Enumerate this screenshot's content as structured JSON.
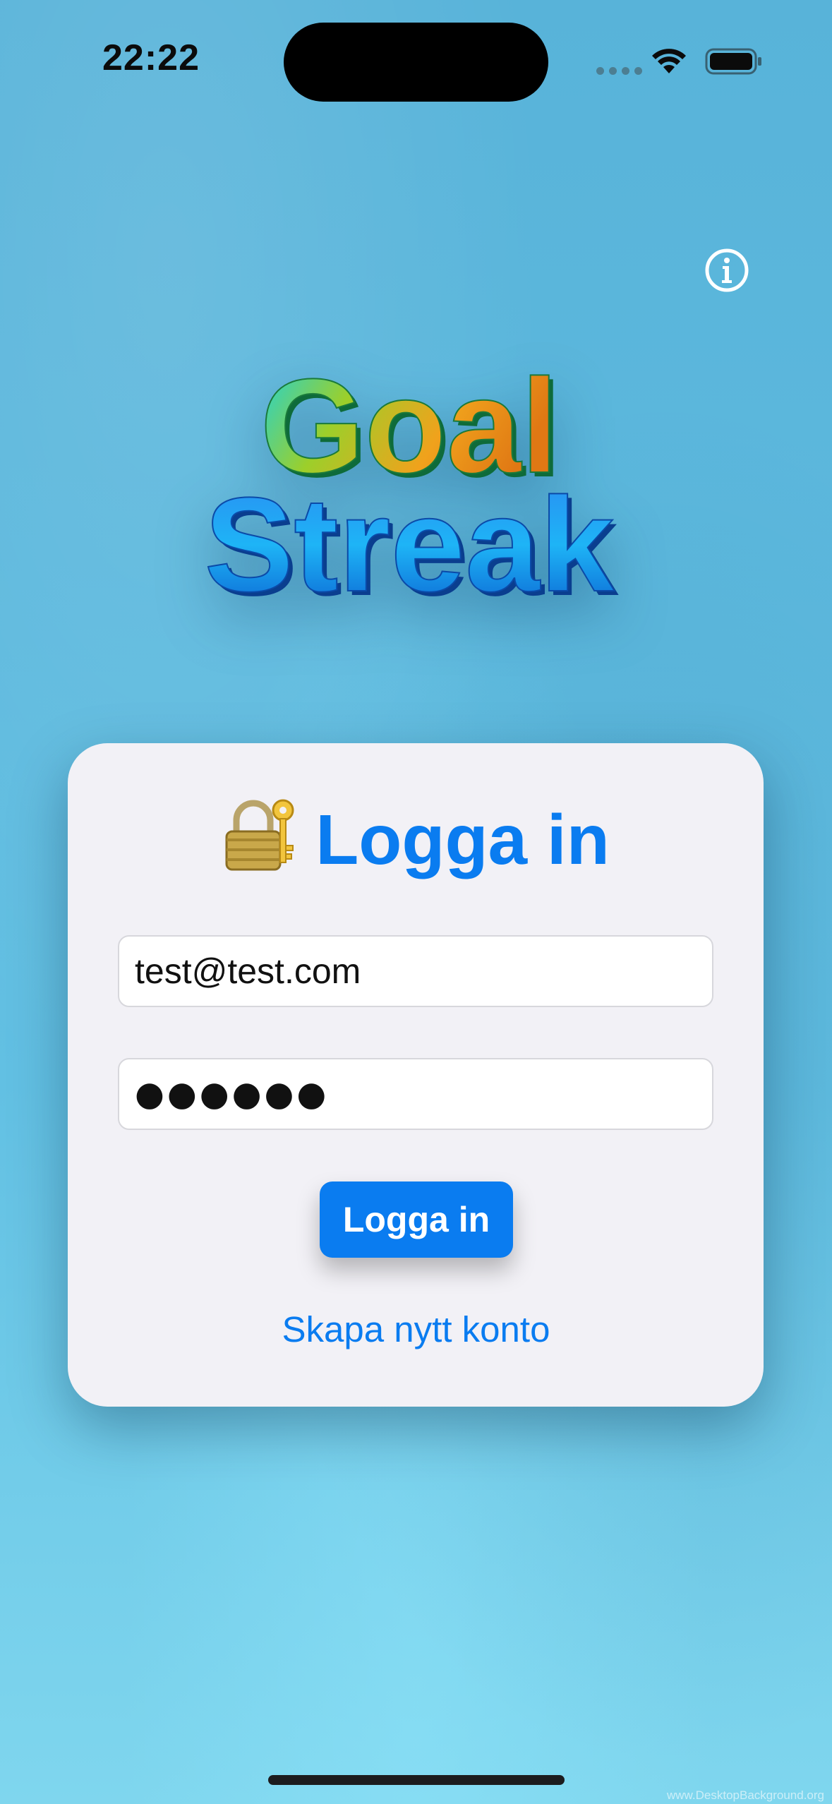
{
  "status_bar": {
    "time": "22:22"
  },
  "header": {
    "info_icon": "info-circle-icon"
  },
  "logo": {
    "line1": "Goal",
    "line2": "Streak"
  },
  "login": {
    "title_icon": "lock-with-key-icon",
    "title": "Logga in",
    "email_value": "test@test.com",
    "password_masked": "●●●●●●",
    "submit_label": "Logga in",
    "create_account_label": "Skapa nytt konto"
  },
  "background": {
    "watermark": "www.DesktopBackground.org"
  },
  "colors": {
    "accent": "#0a7cf0",
    "card": "#f2f1f6",
    "background": "#5cb8dd"
  }
}
